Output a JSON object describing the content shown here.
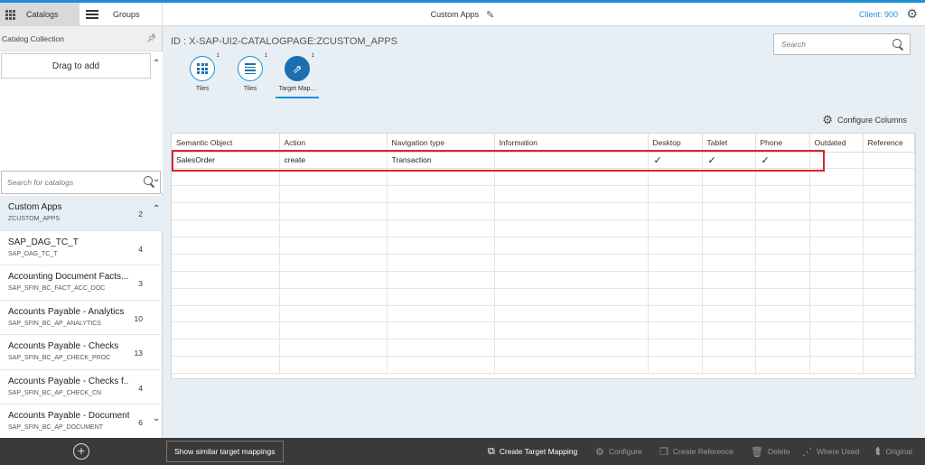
{
  "topbar": {
    "catalogs_label": "Catalogs",
    "groups_label": "Groups",
    "title": "Custom Apps",
    "client": "Client: 900"
  },
  "left": {
    "header": "Catalog Collection",
    "drag_label": "Drag to add",
    "search_placeholder": "Search for catalogs",
    "catalogs": [
      {
        "title": "Custom Apps",
        "id": "ZCUSTOM_APPS",
        "count": "2"
      },
      {
        "title": "SAP_DAG_TC_T",
        "id": "SAP_DAG_TC_T",
        "count": "4"
      },
      {
        "title": "Accounting Document Facts...",
        "id": "SAP_SFIN_BC_FACT_ACC_DOC",
        "count": "3"
      },
      {
        "title": "Accounts Payable - Analytics",
        "id": "SAP_SFIN_BC_AP_ANALYTICS",
        "count": "10"
      },
      {
        "title": "Accounts Payable - Checks",
        "id": "SAP_SFIN_BC_AP_CHECK_PROC",
        "count": "13"
      },
      {
        "title": "Accounts Payable - Checks f...",
        "id": "SAP_SFIN_BC_AP_CHECK_CN",
        "count": "4"
      },
      {
        "title": "Accounts Payable - Document",
        "id": "SAP_SFIN_BC_AP_DOCUMENT",
        "count": "6"
      }
    ]
  },
  "main": {
    "page_id": "ID : X-SAP-UI2-CATALOGPAGE:ZCUSTOM_APPS",
    "search_placeholder": "Search",
    "tabs": [
      {
        "label": "Tiles",
        "badge": "1"
      },
      {
        "label": "Tiles",
        "badge": "1"
      },
      {
        "label": "Target Map...",
        "badge": "1"
      }
    ],
    "configure_columns": "Configure Columns",
    "columns": [
      "Semantic Object",
      "Action",
      "Navigation type",
      "Information",
      "Desktop",
      "Tablet",
      "Phone",
      "Outdated",
      "Reference"
    ],
    "rows": [
      {
        "semantic_object": "SalesOrder",
        "action": "create",
        "navigation_type": "Transaction",
        "information": "",
        "desktop": "✓",
        "tablet": "✓",
        "phone": "✓",
        "outdated": "",
        "reference": ""
      }
    ]
  },
  "footer": {
    "show_similar": "Show similar target mappings",
    "create": "Create Target Mapping",
    "configure": "Configure",
    "create_reference": "Create Reference",
    "delete": "Delete",
    "where_used": "Where Used",
    "original": "Original"
  },
  "colors": {
    "accent": "#1b8fd6",
    "highlight": "#d9252b",
    "footer": "#3a3a3a"
  }
}
